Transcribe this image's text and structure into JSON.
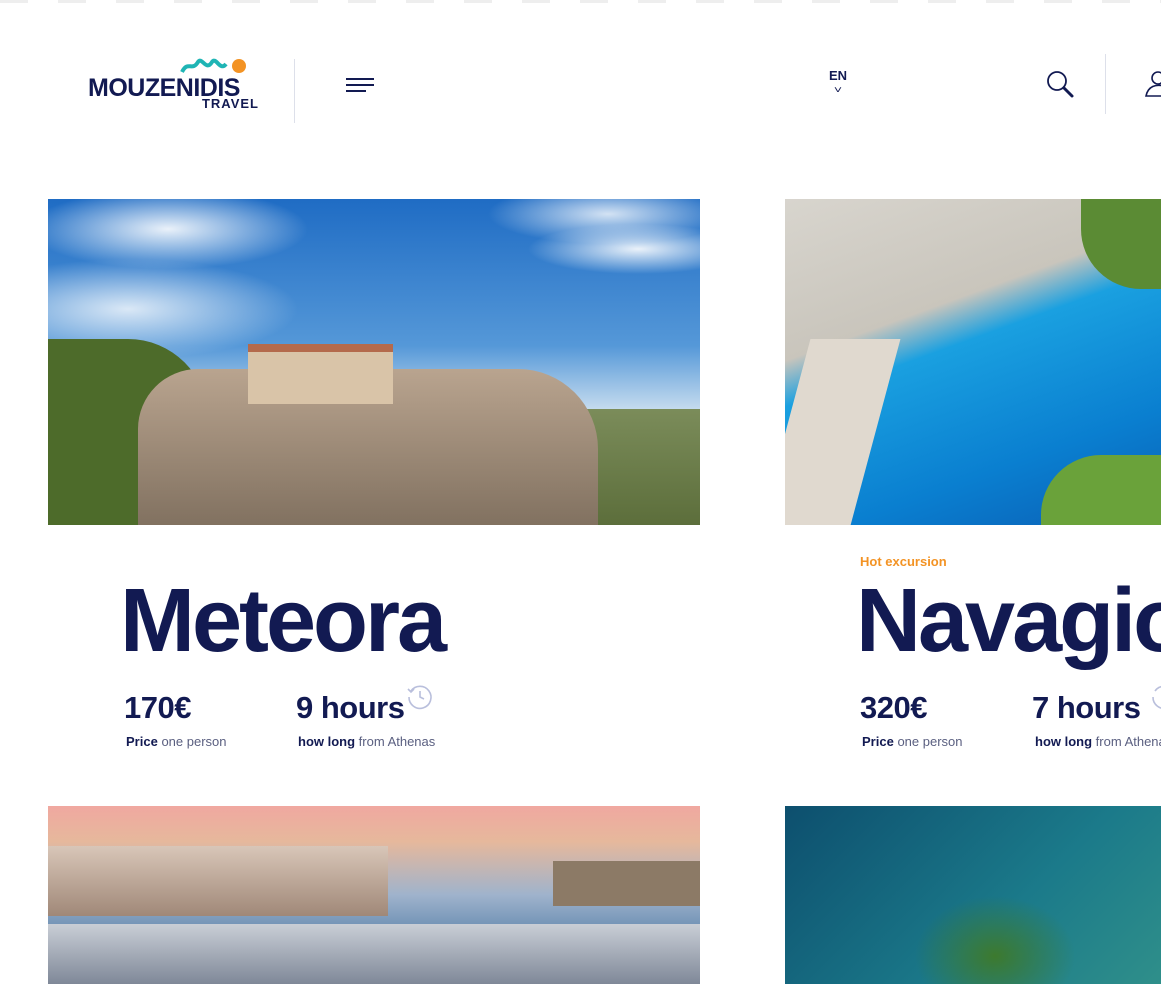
{
  "header": {
    "logo_text": "MOUZENIDIS",
    "logo_sub": "TRAVEL",
    "language": "EN"
  },
  "colors": {
    "brand": "#121a52",
    "accent": "#f39324",
    "wave": "#1fb5b5"
  },
  "tours": [
    {
      "title": "Meteora",
      "tag": "",
      "price": "170€",
      "price_label": "Price",
      "price_note": "one person",
      "duration": "9 hours",
      "duration_label": "how long",
      "duration_note": "from Athenas"
    },
    {
      "title": "Navagio",
      "tag": "Hot excursion",
      "price": "320€",
      "price_label": "Price",
      "price_note": "one person",
      "duration": "7 hours",
      "duration_label": "how long",
      "duration_note": "from Athenas"
    }
  ]
}
